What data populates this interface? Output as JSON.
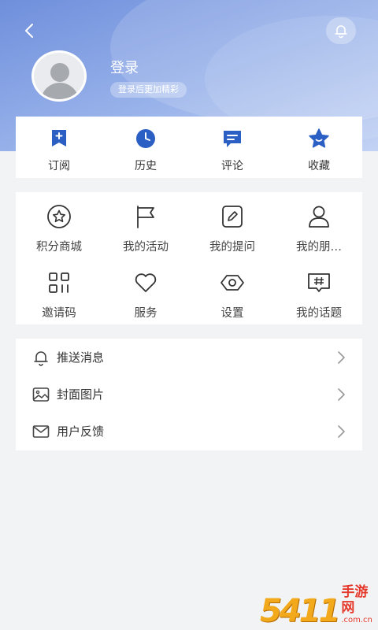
{
  "header": {
    "login_title": "登录",
    "login_subtitle": "登录后更加精彩"
  },
  "quick_actions": [
    {
      "label": "订阅",
      "icon": "subscribe-icon"
    },
    {
      "label": "历史",
      "icon": "clock-icon"
    },
    {
      "label": "评论",
      "icon": "comment-icon"
    },
    {
      "label": "收藏",
      "icon": "star-icon"
    }
  ],
  "grid_menu": [
    {
      "label": "积分商城",
      "icon": "star-circle-icon"
    },
    {
      "label": "我的活动",
      "icon": "flag-icon"
    },
    {
      "label": "我的提问",
      "icon": "edit-icon"
    },
    {
      "label": "我的朋…",
      "icon": "user-icon"
    },
    {
      "label": "邀请码",
      "icon": "qr-code-icon"
    },
    {
      "label": "服务",
      "icon": "heart-icon"
    },
    {
      "label": "设置",
      "icon": "settings-icon"
    },
    {
      "label": "我的话题",
      "icon": "topic-icon"
    }
  ],
  "settings_list": [
    {
      "label": "推送消息",
      "icon": "bell-icon"
    },
    {
      "label": "封面图片",
      "icon": "image-icon"
    },
    {
      "label": "用户反馈",
      "icon": "mail-icon"
    }
  ],
  "watermark": {
    "number": "5411",
    "cn": "手游网",
    "url": ".com.cn"
  },
  "colors": {
    "accent": "#2b5fc4",
    "header_gradient_start": "#6f8fdc",
    "header_gradient_end": "#c3d2f4"
  }
}
